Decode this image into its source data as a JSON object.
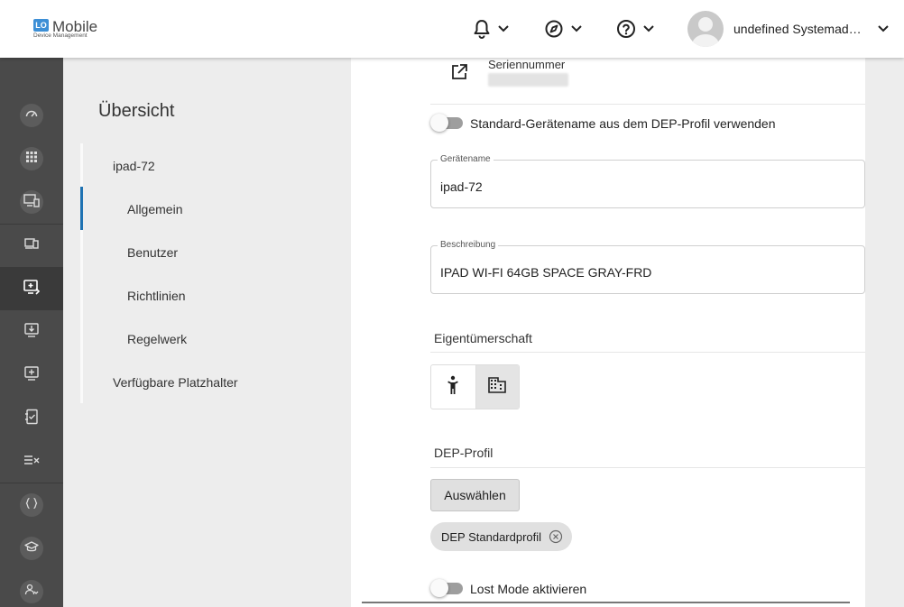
{
  "header": {
    "logo_badge": "LO",
    "logo_text": "Mobile",
    "logo_sub": "Device Management",
    "user_name": "undefined Systemadmi…"
  },
  "leftnav": {
    "icons": [
      "dashboard-icon",
      "apps-grid-icon",
      "device-settings-icon",
      "devices-icon",
      "device-enroll-icon",
      "device-download-icon",
      "device-add-icon",
      "checklist-icon",
      "rules-icon",
      "braces-icon",
      "education-icon",
      "user-group-icon"
    ]
  },
  "subnav": {
    "title": "Übersicht",
    "items": [
      {
        "label": "ipad-72"
      },
      {
        "label": "Allgemein"
      },
      {
        "label": "Benutzer"
      },
      {
        "label": "Richtlinien"
      },
      {
        "label": "Regelwerk"
      },
      {
        "label": "Verfügbare Platzhalter"
      }
    ]
  },
  "main": {
    "serial_label": "Seriennummer",
    "toggle_dep_name_label": "Standard-Gerätename aus dem DEP-Profil verwenden",
    "device_name": {
      "label": "Gerätename",
      "value": "ipad-72"
    },
    "description": {
      "label": "Beschreibung",
      "value": "IPAD WI-FI 64GB SPACE GRAY-FRD"
    },
    "ownership_title": "Eigentümerschaft",
    "dep_profile_title": "DEP-Profil",
    "select_button": "Auswählen",
    "dep_chip": "DEP Standardprofil",
    "lost_mode_label": "Lost Mode aktivieren"
  },
  "colors": {
    "accent": "#1f72b2",
    "nav_bg": "#4a4a4a",
    "page_bg": "#ededed"
  }
}
